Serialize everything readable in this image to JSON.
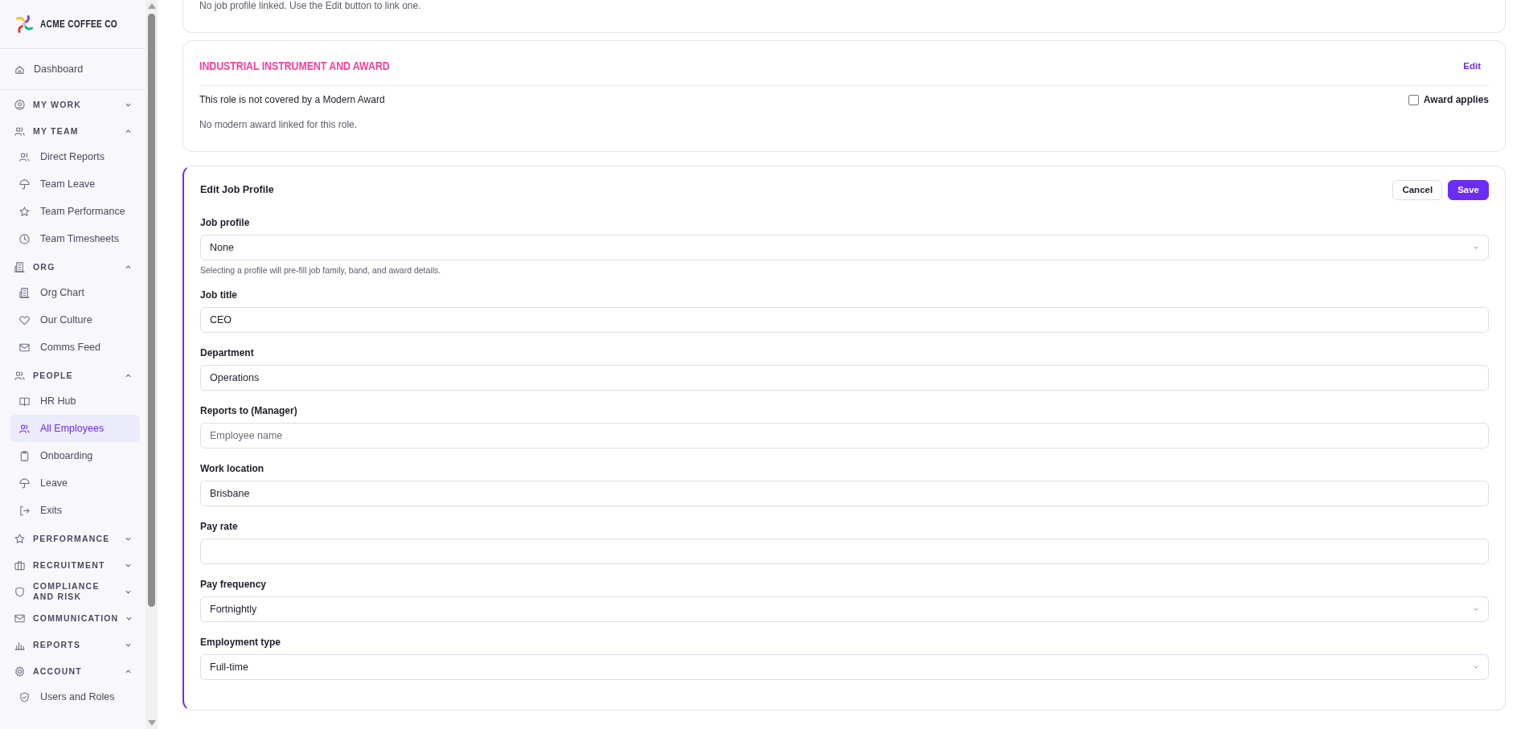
{
  "sidebar": {
    "brand": "ACME COFFEE CO",
    "items": [
      {
        "kind": "link",
        "label": "Dashboard",
        "selected": false
      },
      {
        "kind": "section",
        "label": "MY WORK",
        "expanded": false
      },
      {
        "kind": "section",
        "label": "MY TEAM",
        "expanded": true,
        "children": [
          {
            "label": "Direct Reports",
            "selected": false
          },
          {
            "label": "Team Leave",
            "selected": false
          },
          {
            "label": "Team Performance",
            "selected": false
          },
          {
            "label": "Team Timesheets",
            "selected": false
          }
        ]
      },
      {
        "kind": "section",
        "label": "ORG",
        "expanded": true,
        "children": [
          {
            "label": "Org Chart",
            "selected": false
          },
          {
            "label": "Our Culture",
            "selected": false
          },
          {
            "label": "Comms Feed",
            "selected": false
          }
        ]
      },
      {
        "kind": "section",
        "label": "PEOPLE",
        "expanded": true,
        "children": [
          {
            "label": "HR Hub",
            "selected": false
          },
          {
            "label": "All Employees",
            "selected": true
          },
          {
            "label": "Onboarding",
            "selected": false
          },
          {
            "label": "Leave",
            "selected": false
          },
          {
            "label": "Exits",
            "selected": false
          }
        ]
      },
      {
        "kind": "section",
        "label": "PERFORMANCE",
        "expanded": false
      },
      {
        "kind": "section",
        "label": "RECRUITMENT",
        "expanded": false
      },
      {
        "kind": "section",
        "label": "COMPLIANCE AND RISK",
        "expanded": false
      },
      {
        "kind": "section",
        "label": "COMMUNICATION",
        "expanded": false
      },
      {
        "kind": "section",
        "label": "REPORTS",
        "expanded": false
      },
      {
        "kind": "section",
        "label": "ACCOUNT",
        "expanded": true,
        "children": [
          {
            "label": "Users and Roles",
            "selected": false
          }
        ]
      }
    ]
  },
  "job_profile_card": {
    "text": "No job profile linked. Use the Edit button to link one."
  },
  "award_card": {
    "title": "INDUSTRIAL INSTRUMENT AND AWARD",
    "edit": "Edit",
    "coverage": "This role is not covered by a Modern Award",
    "award_applies": {
      "label": "Award applies",
      "checked": false
    },
    "note": "No modern award linked for this role."
  },
  "edit_form": {
    "title": "Edit Job Profile",
    "cancel": "Cancel",
    "save": "Save",
    "fields": [
      {
        "kind": "select",
        "label": "Job profile",
        "value": "None",
        "hint": "Selecting a profile will pre-fill job family, band, and award details."
      },
      {
        "kind": "text",
        "label": "Job title",
        "value": "CEO"
      },
      {
        "kind": "text",
        "label": "Department",
        "value": "Operations"
      },
      {
        "kind": "text",
        "label": "Reports to (Manager)",
        "placeholder": "Employee name"
      },
      {
        "kind": "text",
        "label": "Work location",
        "value": "Brisbane"
      },
      {
        "kind": "text",
        "label": "Pay rate"
      },
      {
        "kind": "select",
        "label": "Pay frequency",
        "value": "Fortnightly"
      },
      {
        "kind": "select",
        "label": "Employment type",
        "value": "Full-time"
      }
    ]
  }
}
